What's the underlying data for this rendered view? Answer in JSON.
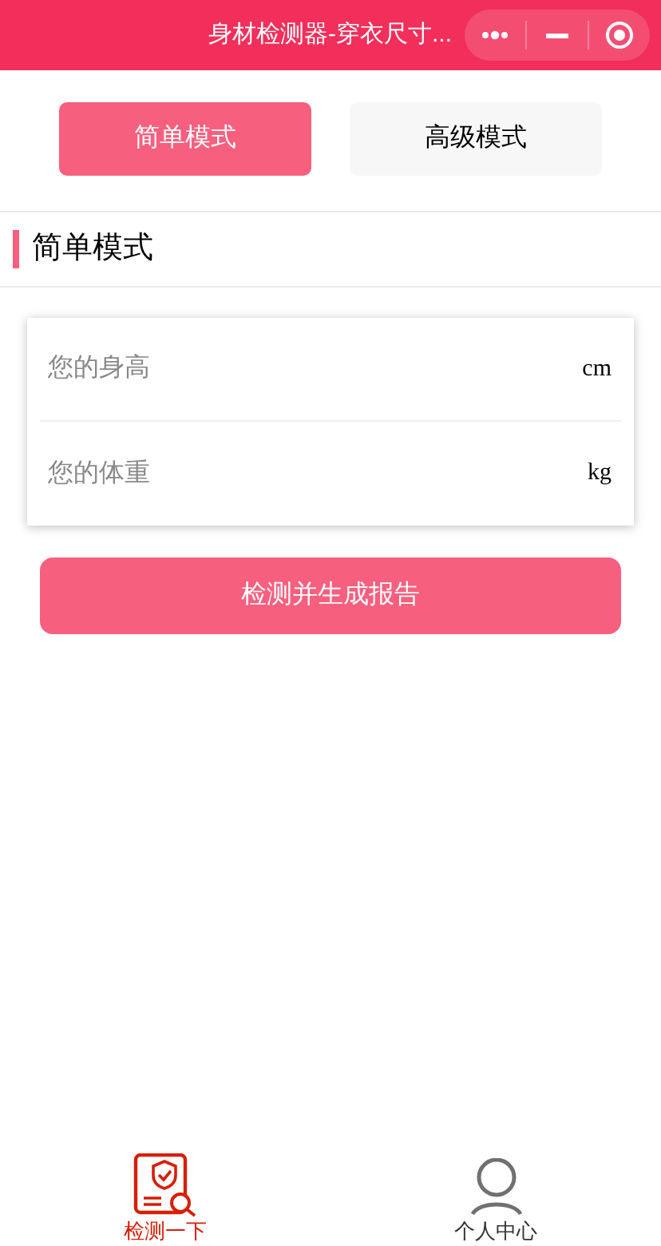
{
  "window": {
    "title": "身材检测器-穿衣尺寸..."
  },
  "mode_tabs": [
    {
      "label": "简单模式",
      "selected": true
    },
    {
      "label": "高级模式",
      "selected": false
    }
  ],
  "section": {
    "title": "简单模式"
  },
  "fields": [
    {
      "placeholder": "您的身高",
      "unit": "cm"
    },
    {
      "placeholder": "您的体重",
      "unit": "kg"
    }
  ],
  "submit_button": "检测并生成报告",
  "tab_bar": [
    {
      "label": "检测一下",
      "kind": "check",
      "selected": true
    },
    {
      "label": "个人中心",
      "kind": "profile",
      "selected": false
    }
  ]
}
